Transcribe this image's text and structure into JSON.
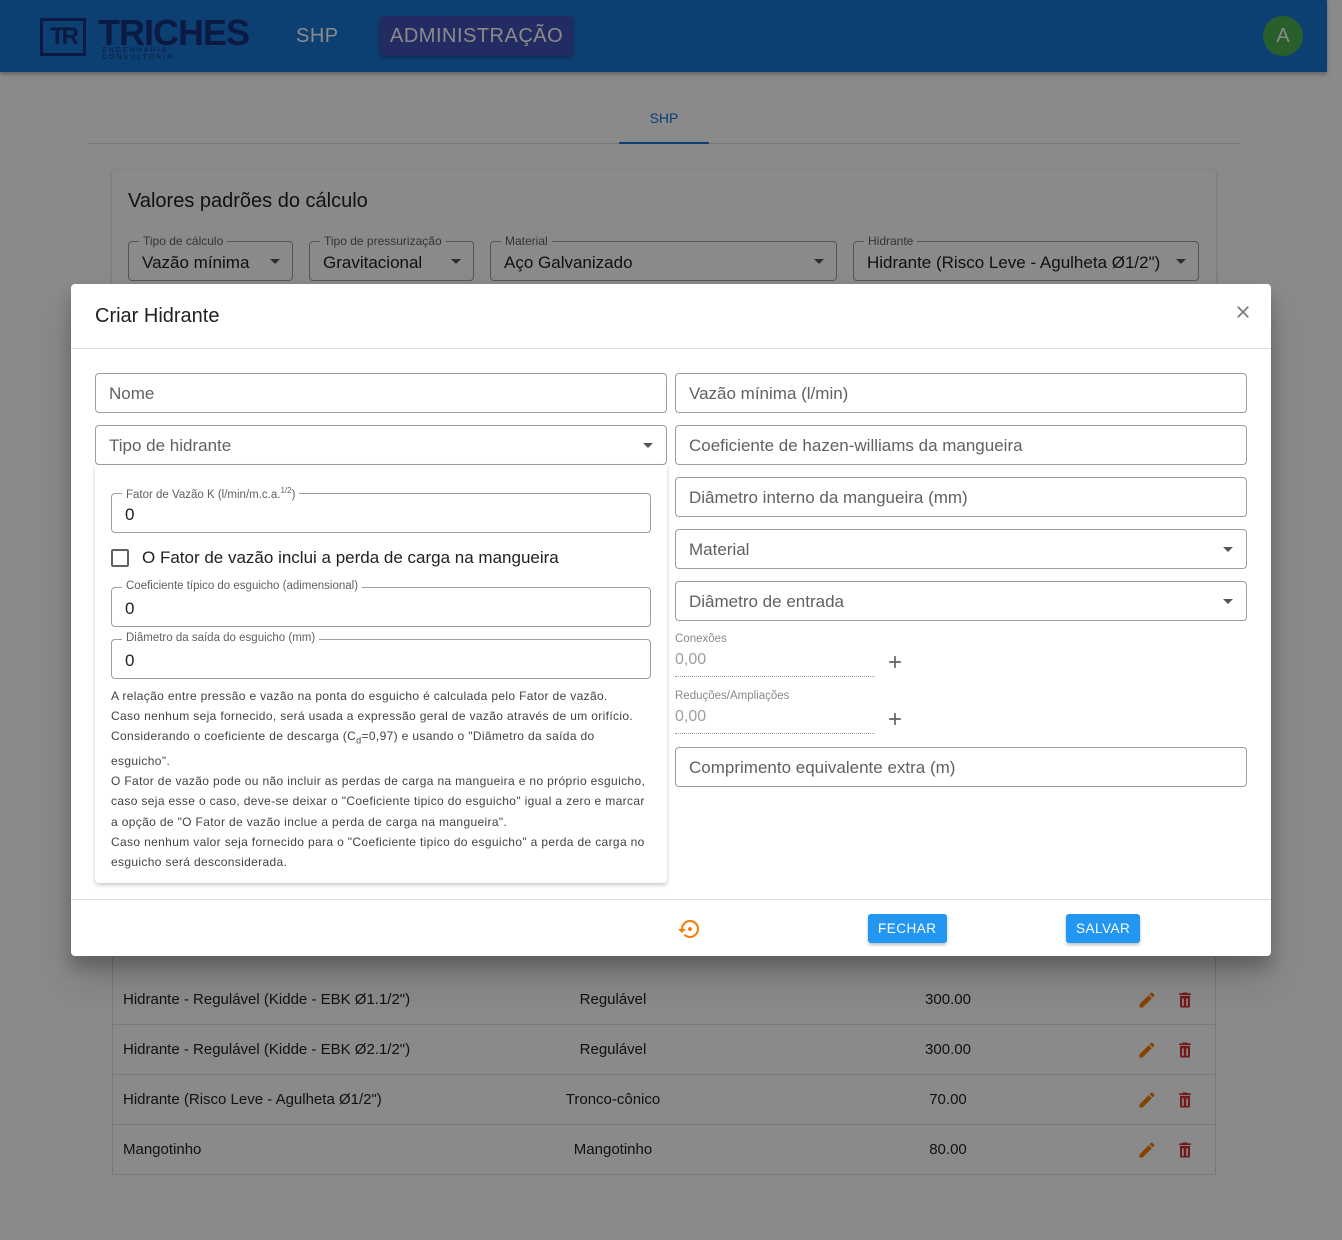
{
  "app": {
    "logo_mark": "TR",
    "logo_word": "TRICHES",
    "logo_sub": "ENGENHARIA CONSULTORIA",
    "nav": [
      "SHP",
      "ADMINISTRAÇÃO"
    ],
    "avatar": "A"
  },
  "tabs": [
    "SHP"
  ],
  "card": {
    "title": "Valores padrões do cálculo",
    "selects": [
      {
        "label": "Tipo de cálculo",
        "value": "Vazão mínima"
      },
      {
        "label": "Tipo de pressurização",
        "value": "Gravitacional"
      },
      {
        "label": "Material",
        "value": "Aço Galvanizado"
      },
      {
        "label": "Hidrante",
        "value": "Hidrante (Risco Leve - Agulheta Ø1/2\")"
      }
    ]
  },
  "table": {
    "rows": [
      {
        "name": "Hidrante - Regulável (Kidde - EBK Ø1.1/2\")",
        "type": "Regulável",
        "flow": "300.00"
      },
      {
        "name": "Hidrante - Regulável (Kidde - EBK Ø2.1/2\")",
        "type": "Regulável",
        "flow": "300.00"
      },
      {
        "name": "Hidrante (Risco Leve - Agulheta Ø1/2\")",
        "type": "Tronco-cônico",
        "flow": "70.00"
      },
      {
        "name": "Mangotinho",
        "type": "Mangotinho",
        "flow": "80.00"
      }
    ]
  },
  "dialog": {
    "title": "Criar Hidrante",
    "nome_placeholder": "Nome",
    "tipo_placeholder": "Tipo de hidrante",
    "vazao_placeholder": "Vazão mínima (l/min)",
    "hazen_placeholder": "Coeficiente de hazen-williams da mangueira",
    "diametro_mangueira_placeholder": "Diâmetro interno da mangueira (mm)",
    "material_placeholder": "Material",
    "diametro_entrada_placeholder": "Diâmetro de entrada",
    "fator_label": "Fator de Vazão K (l/min/m.c.a.",
    "fator_label_sup": "1/2",
    "fator_label_end": ")",
    "fator_value": "0",
    "checkbox_label": "O Fator de vazão inclui a perda de carga na mangueira",
    "coef_label": "Coeficiente típico do esguicho (adimensional)",
    "coef_value": "0",
    "diam_saida_label": "Diâmetro da saída do esguicho (mm)",
    "diam_saida_value": "0",
    "help": {
      "l1": "A relação entre pressão e vazão na ponta do esguicho é calculada pelo Fator de vazão.",
      "l2": "Caso nenhum seja fornecido, será usada a expressão geral de vazão através de um orifício.",
      "l3a": "Considerando o coeficiente de descarga (C",
      "l3sub": "d",
      "l3b": "=0,97) e usando o \"Diâmetro da saída do esguicho\".",
      "l4": "O Fator de vazão pode ou não incluir as perdas de carga na mangueira e no próprio esguicho, caso seja esse o caso, deve-se deixar o \"Coeficiente tipico do esguicho\" igual a zero e marcar a opção de \"O Fator de vazão inclue a perda de carga na mangueira\".",
      "l5": "Caso nenhum valor seja fornecido para o \"Coeficiente tipico do esguicho\" a perda de carga no esguicho será desconsiderada."
    },
    "conexoes_label": "Conexões",
    "conexoes_value": "0,00",
    "reducoes_label": "Reduções/Ampliações",
    "reducoes_value": "0,00",
    "comprimento_placeholder": "Comprimento equivalente extra (m)",
    "btn_close": "FECHAR",
    "btn_save": "SALVAR"
  },
  "colors": {
    "primary": "#1976d2",
    "accent": "#2196f3",
    "admin_nav": "#3f51b5",
    "avatar": "#4caf50",
    "edit_icon": "#f57c00",
    "delete_icon": "#d32f2f"
  }
}
